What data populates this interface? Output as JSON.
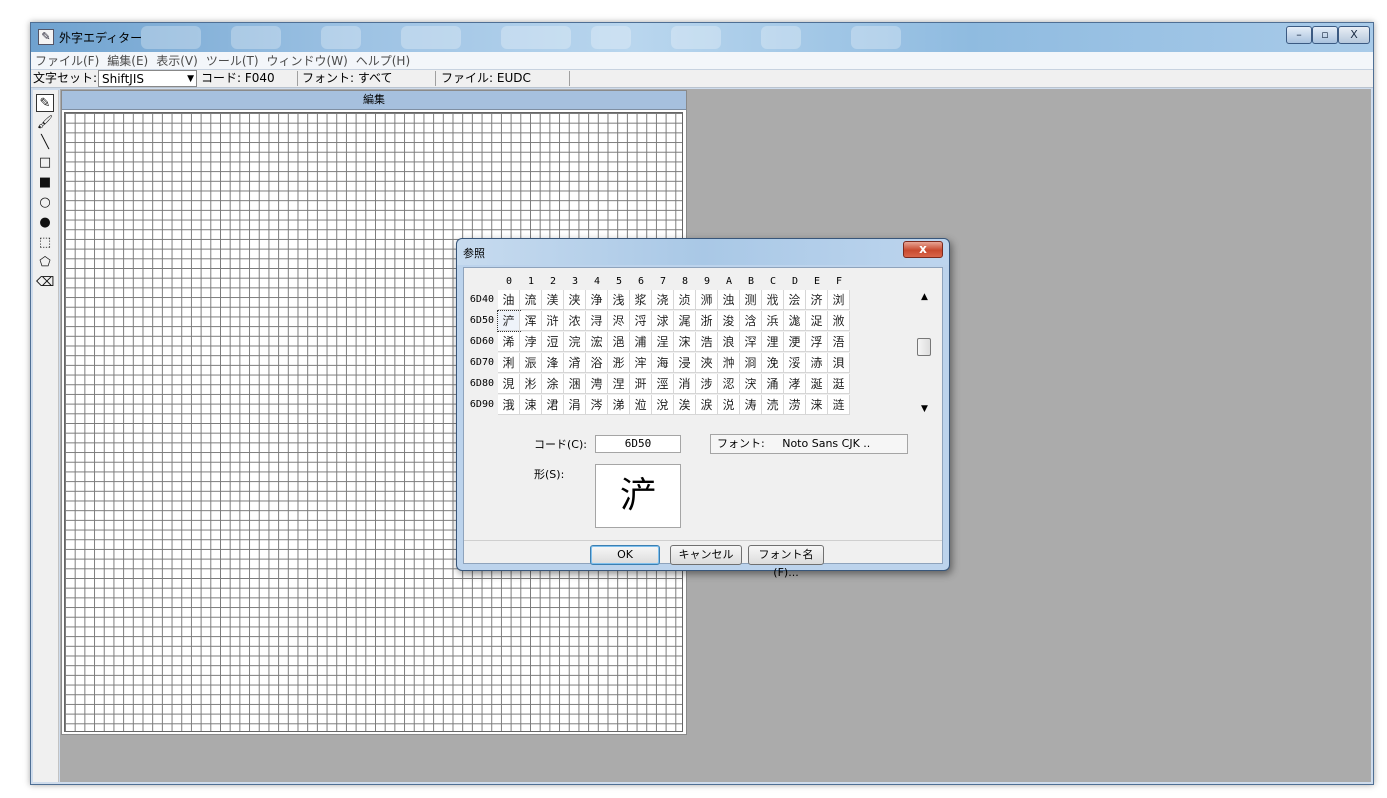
{
  "window": {
    "title": "外字エディター",
    "min_glyph": "–",
    "max_glyph": "▫",
    "close_glyph": "X"
  },
  "menubar": {
    "items": [
      "ファイル(F)",
      "編集(E)",
      "表示(V)",
      "ツール(T)",
      "ウィンドウ(W)",
      "ヘルプ(H)"
    ]
  },
  "infobar": {
    "charset_label": "文字セット:",
    "charset_value": "ShiftJIS",
    "code": "コード: F040",
    "font": "フォント: すべて",
    "file": "ファイル: EUDC"
  },
  "toolbox": {
    "tools": [
      {
        "name": "pencil-tool-icon",
        "glyph": "✎"
      },
      {
        "name": "brush-tool-icon",
        "glyph": "🖌"
      },
      {
        "name": "line-tool-icon",
        "glyph": "╲"
      },
      {
        "name": "hollow-rectangle-tool-icon",
        "glyph": "□"
      },
      {
        "name": "filled-rectangle-tool-icon",
        "glyph": "■"
      },
      {
        "name": "hollow-ellipse-tool-icon",
        "glyph": "○"
      },
      {
        "name": "filled-ellipse-tool-icon",
        "glyph": "●"
      },
      {
        "name": "rectangle-select-tool-icon",
        "glyph": "⬚"
      },
      {
        "name": "freeform-select-tool-icon",
        "glyph": "⬠"
      },
      {
        "name": "eraser-tool-icon",
        "glyph": "⌫"
      }
    ]
  },
  "edit_panel": {
    "title": "編集"
  },
  "reference_dialog": {
    "title": "参照",
    "close_glyph": "x",
    "column_headers": [
      "0",
      "1",
      "2",
      "3",
      "4",
      "5",
      "6",
      "7",
      "8",
      "9",
      "A",
      "B",
      "C",
      "D",
      "E",
      "F"
    ],
    "rows": [
      {
        "code": "6D40",
        "chars": [
          "油",
          "流",
          "渼",
          "浃",
          "浄",
          "浅",
          "浆",
          "浇",
          "浈",
          "浉",
          "浊",
          "测",
          "浌",
          "浍",
          "济",
          "浏"
        ]
      },
      {
        "code": "6D50",
        "chars": [
          "浐",
          "浑",
          "浒",
          "浓",
          "浔",
          "浕",
          "浖",
          "浗",
          "浘",
          "浙",
          "浚",
          "浛",
          "浜",
          "浝",
          "浞",
          "浟"
        ]
      },
      {
        "code": "6D60",
        "chars": [
          "浠",
          "浡",
          "浢",
          "浣",
          "浤",
          "浥",
          "浦",
          "浧",
          "浨",
          "浩",
          "浪",
          "浫",
          "浬",
          "浭",
          "浮",
          "浯"
        ]
      },
      {
        "code": "6D70",
        "chars": [
          "浰",
          "浱",
          "浲",
          "浳",
          "浴",
          "浵",
          "浶",
          "海",
          "浸",
          "浹",
          "浺",
          "浻",
          "浼",
          "浽",
          "浾",
          "浿"
        ]
      },
      {
        "code": "6D80",
        "chars": [
          "涀",
          "涁",
          "涂",
          "涃",
          "涄",
          "涅",
          "涆",
          "涇",
          "消",
          "涉",
          "涊",
          "涋",
          "涌",
          "涍",
          "涎",
          "涏"
        ]
      },
      {
        "code": "6D90",
        "chars": [
          "涐",
          "涑",
          "涒",
          "涓",
          "涔",
          "涕",
          "涖",
          "涗",
          "涘",
          "涙",
          "涚",
          "涛",
          "涜",
          "涝",
          "涞",
          "涟"
        ]
      }
    ],
    "selected": {
      "row": 1,
      "col": 0
    },
    "code_label": "コード(C):",
    "code_value": "6D50",
    "font_label": "フォント:",
    "font_value": "Noto Sans CJK ..",
    "shape_label": "形(S):",
    "shape_char": "浐",
    "ok_label": "OK",
    "cancel_label": "キャンセル",
    "fontname_label": "フォント名(F)...",
    "scroll_up_glyph": "▲",
    "scroll_down_glyph": "▼"
  }
}
